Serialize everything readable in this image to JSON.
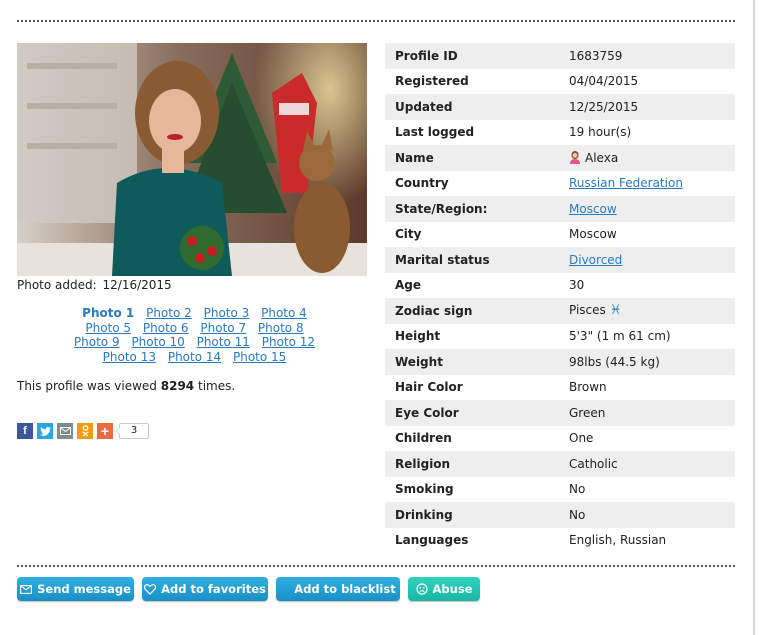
{
  "photo": {
    "added_label": "Photo added:",
    "added_date": "12/16/2015"
  },
  "photo_links": [
    [
      "Photo 1",
      "Photo 2",
      "Photo 3",
      "Photo 4"
    ],
    [
      "Photo 5",
      "Photo 6",
      "Photo 7",
      "Photo 8"
    ],
    [
      "Photo 9",
      "Photo 10",
      "Photo 11",
      "Photo 12"
    ],
    [
      "Photo 13",
      "Photo 14",
      "Photo 15"
    ]
  ],
  "active_photo": "Photo 1",
  "views": {
    "prefix": "This profile was viewed",
    "count": "8294",
    "suffix": "times."
  },
  "share": {
    "icons": [
      "facebook-icon",
      "twitter-icon",
      "email-icon",
      "odnoklassniki-icon",
      "more-icon"
    ],
    "count": "3"
  },
  "profile": [
    {
      "key": "Profile ID",
      "value": "1683759"
    },
    {
      "key": "Registered",
      "value": "04/04/2015"
    },
    {
      "key": "Updated",
      "value": "12/25/2015"
    },
    {
      "key": "Last logged",
      "value": "19 hour(s)"
    },
    {
      "key": "Name",
      "value": "Alexa",
      "icon": "female-user-icon"
    },
    {
      "key": "Country",
      "value": "Russian Federation",
      "link": true
    },
    {
      "key": "State/Region:",
      "value": "Moscow",
      "link": true
    },
    {
      "key": "City",
      "value": "Moscow"
    },
    {
      "key": "Marital status",
      "value": "Divorced",
      "link": true
    },
    {
      "key": "Age",
      "value": "30"
    },
    {
      "key": "Zodiac sign",
      "value": "Pisces",
      "symbol": "♓"
    },
    {
      "key": "Height",
      "value": "5'3\" (1 m 61 cm)"
    },
    {
      "key": "Weight",
      "value": "98lbs (44.5 kg)"
    },
    {
      "key": "Hair Color",
      "value": "Brown"
    },
    {
      "key": "Eye Color",
      "value": "Green"
    },
    {
      "key": "Children",
      "value": "One"
    },
    {
      "key": "Religion",
      "value": "Catholic"
    },
    {
      "key": "Smoking",
      "value": "No"
    },
    {
      "key": "Drinking",
      "value": "No"
    },
    {
      "key": "Languages",
      "value": "English, Russian"
    }
  ],
  "actions": {
    "send_message": "Send message",
    "add_favorites": "Add to favorites",
    "add_blacklist": "Add to blacklist",
    "abuse": "Abuse"
  },
  "colors": {
    "link": "#2a7ac0",
    "button_blue": "#1a9ad6",
    "button_teal": "#22c4ae",
    "row_stripe": "#eeeeee"
  }
}
